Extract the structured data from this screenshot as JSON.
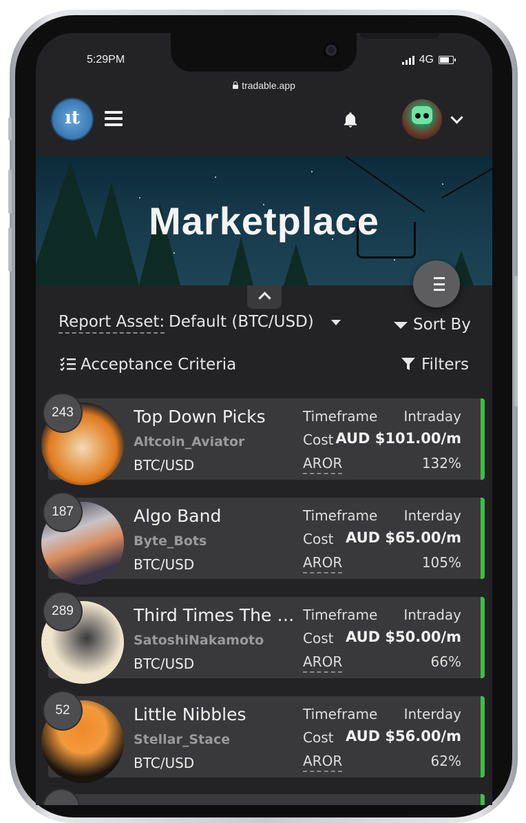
{
  "status_bar": {
    "time": "5:29PM",
    "network": "4G"
  },
  "browser": {
    "url": "tradable.app"
  },
  "header": {
    "logo_text": "ıt"
  },
  "banner": {
    "title": "Marketplace"
  },
  "controls": {
    "report_asset_label": "Report Asset:",
    "report_asset_value": "Default (BTC/USD)",
    "sort_by_label": "Sort By",
    "acceptance_criteria_label": "Acceptance Criteria",
    "filters_label": "Filters"
  },
  "cards": [
    {
      "rank": "243",
      "title": "Top Down Picks",
      "author": "Altcoin_Aviator",
      "pair": "BTC/USD",
      "timeframe_label": "Timeframe",
      "timeframe": "Intraday",
      "cost_label": "Cost",
      "cost": "AUD $101.00/m",
      "aror_label": "AROR",
      "aror": "132%"
    },
    {
      "rank": "187",
      "title": "Algo Band",
      "author": "Byte_Bots",
      "pair": "BTC/USD",
      "timeframe_label": "Timeframe",
      "timeframe": "Interday",
      "cost_label": "Cost",
      "cost": "AUD $65.00/m",
      "aror_label": "AROR",
      "aror": "105%"
    },
    {
      "rank": "289",
      "title": "Third Times The Ch…",
      "author": "SatoshiNakamoto",
      "pair": "BTC/USD",
      "timeframe_label": "Timeframe",
      "timeframe": "Intraday",
      "cost_label": "Cost",
      "cost": "AUD $50.00/m",
      "aror_label": "AROR",
      "aror": "66%"
    },
    {
      "rank": "52",
      "title": "Little Nibbles",
      "author": "Stellar_Stace",
      "pair": "BTC/USD",
      "timeframe_label": "Timeframe",
      "timeframe": "Interday",
      "cost_label": "Cost",
      "cost": "AUD $56.00/m",
      "aror_label": "AROR",
      "aror": "62%"
    }
  ],
  "colors": {
    "accent_green": "#3cbf46",
    "card_bg": "#39393b",
    "screen_bg": "#232325"
  },
  "icons": {
    "menu": "hamburger-icon",
    "notifications": "bell-icon",
    "account_menu": "chevron-down-icon",
    "checklist": "checklist-icon",
    "filter": "funnel-icon",
    "collapse": "chevron-up-icon"
  }
}
